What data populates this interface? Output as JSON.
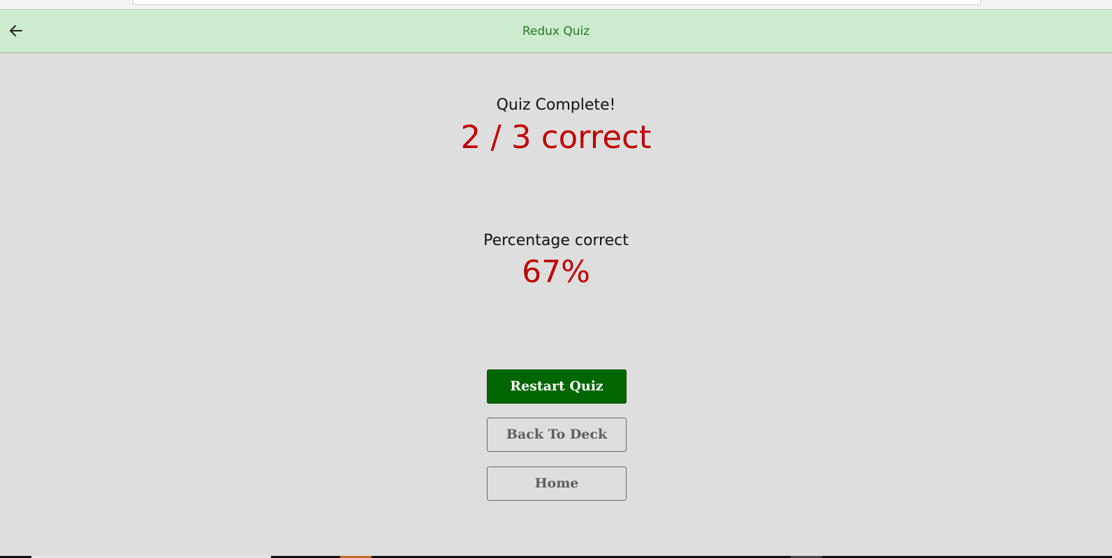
{
  "app": {
    "title": "Redux Quiz"
  },
  "result": {
    "heading": "Quiz Complete!",
    "score": "2 / 3 correct",
    "percentage_label": "Percentage correct",
    "percentage_value": "67%"
  },
  "actions": {
    "restart_label": "Restart Quiz",
    "back_to_deck_label": "Back To Deck",
    "home_label": "Home"
  },
  "icons": {
    "back": "arrow-left-icon"
  },
  "colors": {
    "header_bg": "#cdebcf",
    "title_green": "#1f7a1f",
    "score_red": "#c00000",
    "primary_button": "#006600",
    "page_bg": "#dedede"
  }
}
